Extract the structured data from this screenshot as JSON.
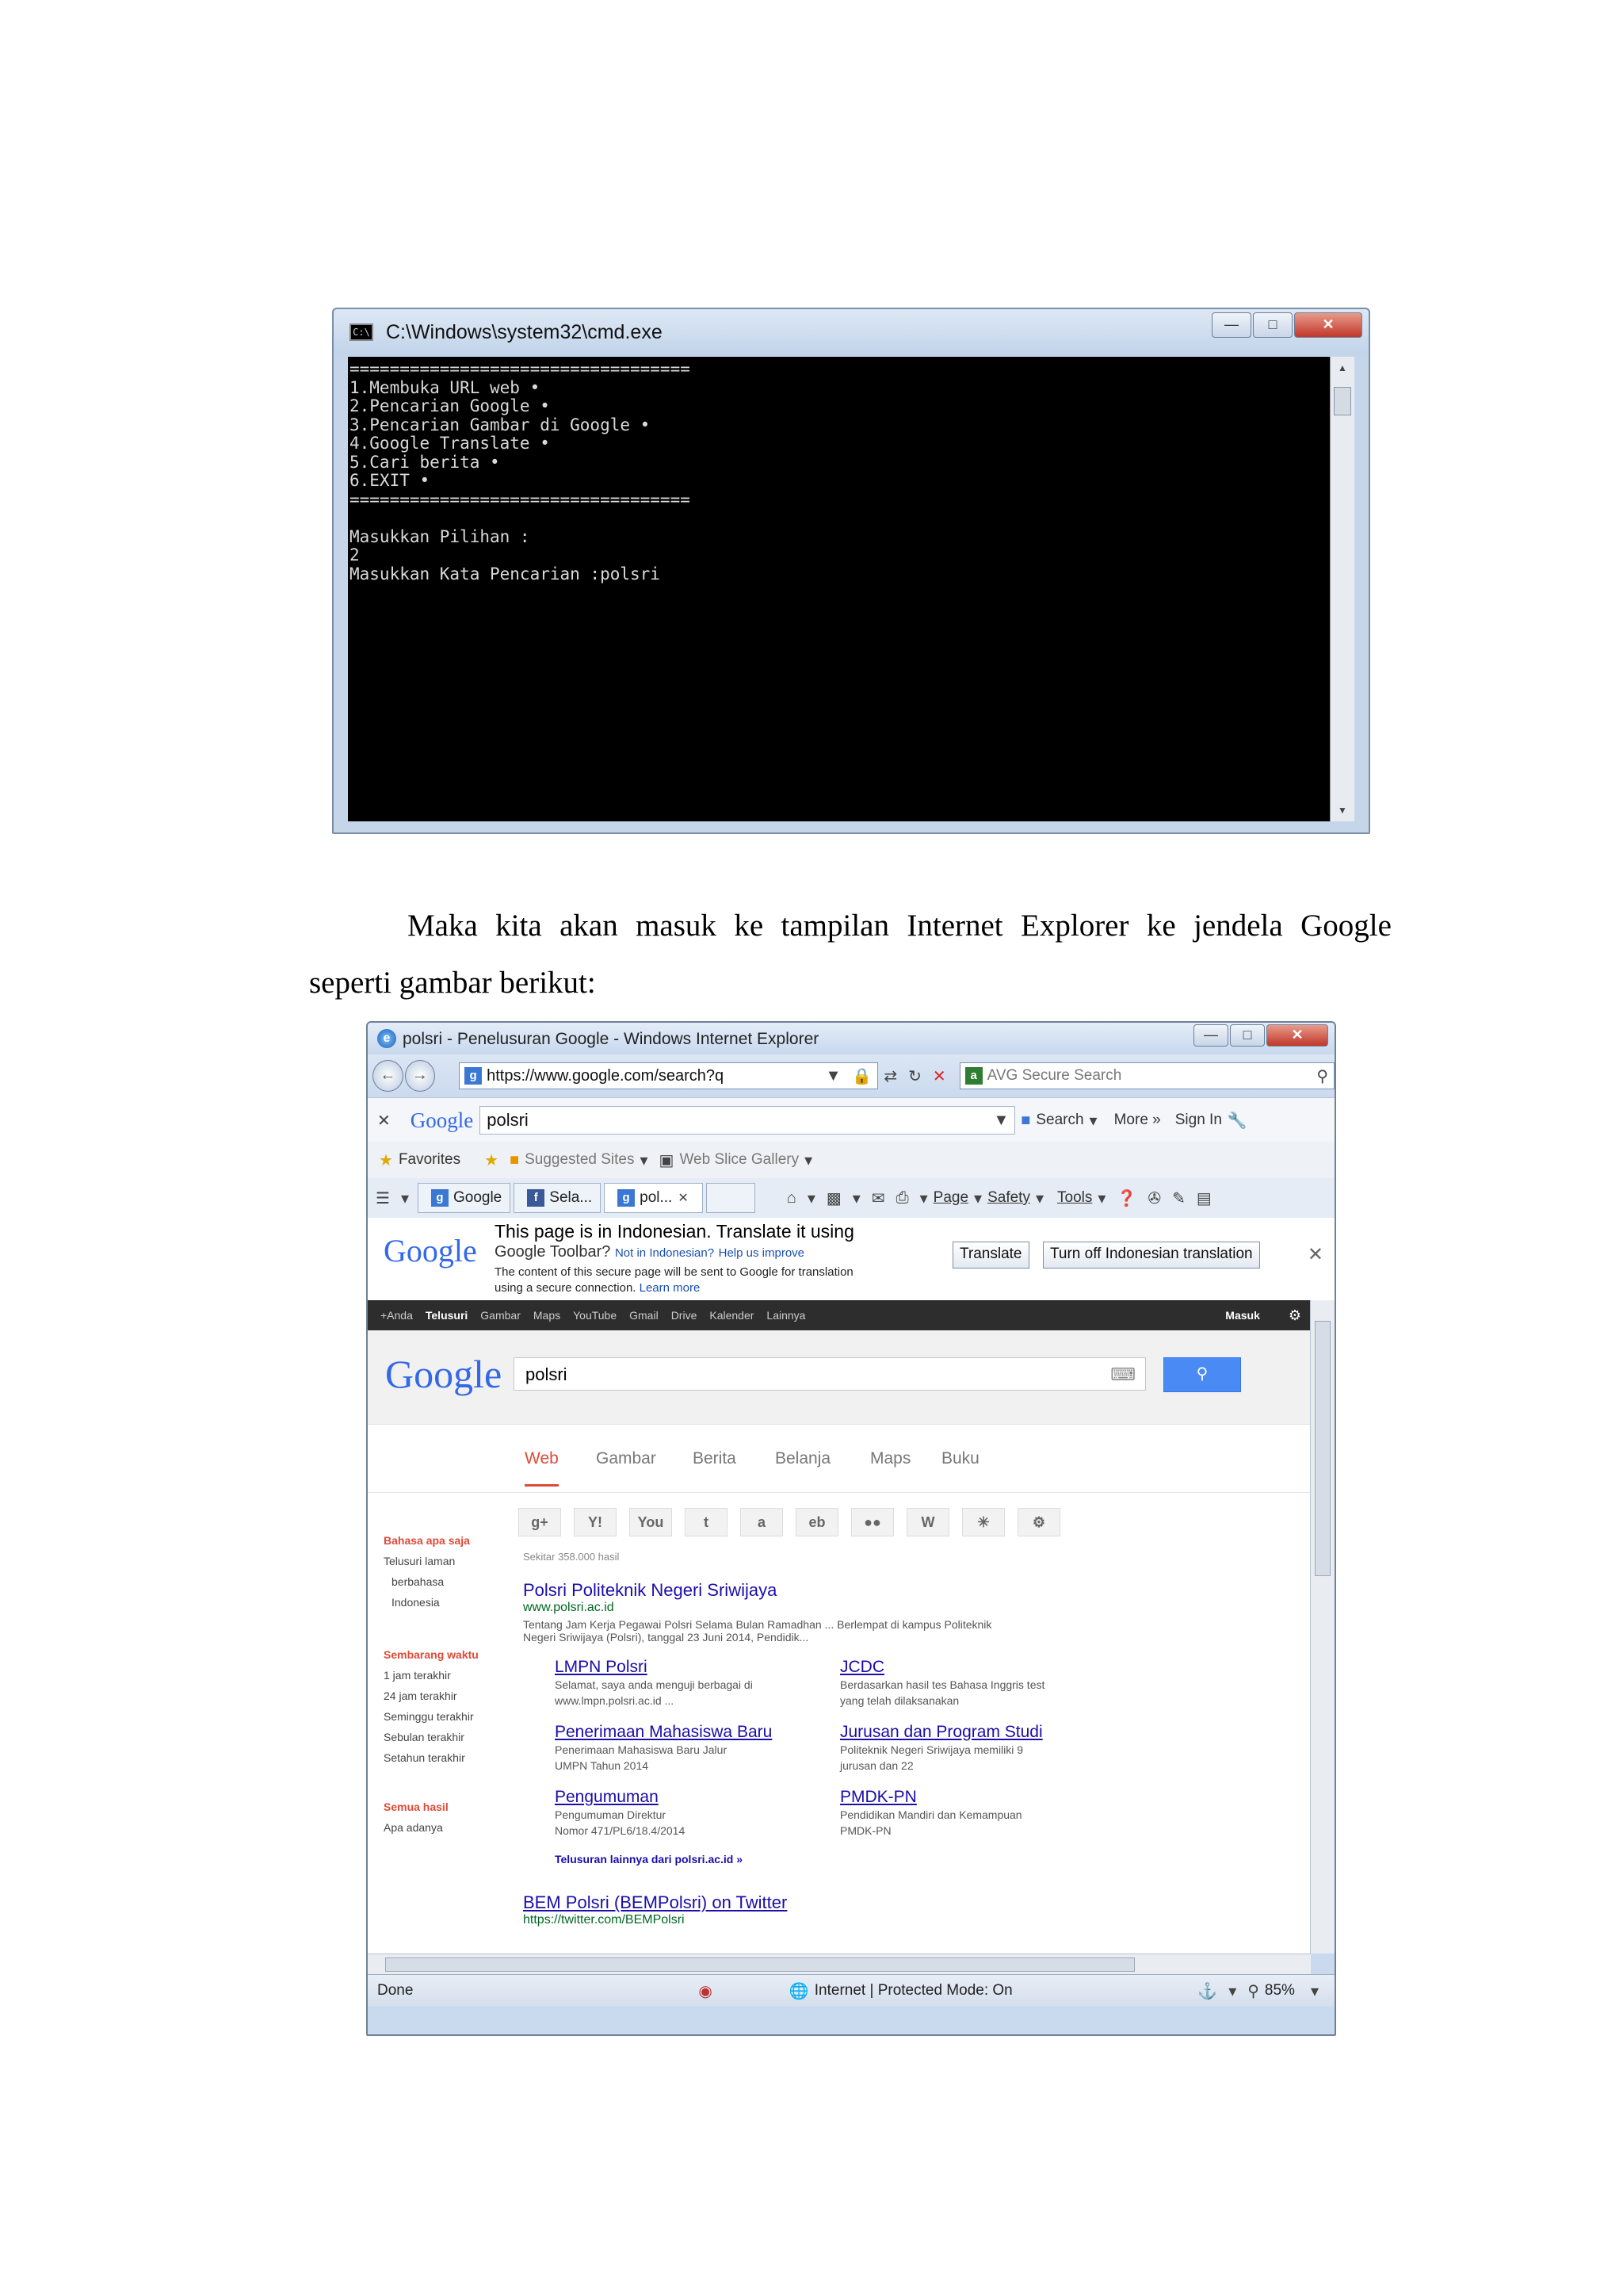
{
  "cmd_window": {
    "title": "C:\\Windows\\system32\\cmd.exe",
    "lines": [
      "==================================",
      "1.Membuka URL web •",
      "2.Pencarian Google •",
      "3.Pencarian Gambar di Google •",
      "4.Google Translate •",
      "5.Cari berita •",
      "6.EXIT •",
      "==================================",
      "",
      "Masukkan Pilihan :",
      "2",
      "Masukkan Kata Pencarian :polsri"
    ]
  },
  "paragraph": {
    "line1_words": [
      "Maka",
      "kita",
      "akan",
      "masuk",
      "ke",
      "tampilan",
      "Internet",
      "Explorer",
      "ke",
      "jendela",
      "Google"
    ],
    "line2": "seperti gambar berikut:"
  },
  "ie_window": {
    "title": "polsri - Penelusuran Google - Windows Internet Explorer",
    "address": "https://www.google.com/search?q",
    "search_placeholder": "AVG Secure Search",
    "google_toolbar": {
      "logo": "Google",
      "query": "polsri",
      "search_label": "Search",
      "more_label": "More »",
      "signin_label": "Sign In"
    },
    "favorites": {
      "favorites_label": "Favorites",
      "suggested_label": "Suggested Sites",
      "webslice_label": "Web Slice Gallery"
    },
    "tabs": [
      {
        "label": "Google"
      },
      {
        "label": "Sela..."
      },
      {
        "label": "pol..."
      }
    ],
    "command_bar": {
      "page": "Page",
      "safety": "Safety",
      "tools": "Tools"
    },
    "translate_bar": {
      "logo": "Google",
      "line1": "This page is in Indonesian.  Translate it using",
      "line2a": "Google Toolbar?",
      "line2b": "Not in Indonesian?",
      "line2c": "Help us improve",
      "line3": "The content of this secure page will be sent to Google for translation",
      "line4a": "using a secure connection.",
      "line4b": "Learn more",
      "translate_btn": "Translate",
      "turnoff_btn": "Turn off Indonesian translation"
    },
    "google_bar": {
      "items": [
        "+Anda",
        "Telusuri",
        "Gambar",
        "Maps",
        "YouTube",
        "Gmail",
        "Drive",
        "Kalender",
        "Lainnya"
      ],
      "masuk": "Masuk"
    },
    "google_search": {
      "logo": "Google",
      "query": "polsri"
    },
    "google_tabs": [
      "Web",
      "Gambar",
      "Berita",
      "Belanja",
      "Maps",
      "Buku"
    ],
    "left_col": {
      "lang_header": "Bahasa apa saja",
      "lang_items": [
        "Telusuri laman",
        "berbahasa",
        "Indonesia"
      ],
      "time_header": "Sembarang waktu",
      "time_items": [
        "1 jam terakhir",
        "24 jam terakhir",
        "Seminggu terakhir",
        "Sebulan terakhir",
        "Setahun terakhir"
      ],
      "all_header": "Semua hasil",
      "all_items": [
        "Apa adanya"
      ]
    },
    "result_stats": "Sekitar 358.000 hasil",
    "results": [
      {
        "title": "Polsri Politeknik Negeri Sriwijaya",
        "url": "www.polsri.ac.id",
        "snippet1": "Tentang Jam Kerja Pegawai Polsri Selama Bulan Ramadhan ... Berlempat di kampus Politeknik",
        "snippet2": "Negeri Sriwijaya (Polsri), tanggal 23 Juni 2014, Pendidik..."
      }
    ],
    "sitelinks": [
      {
        "title": "LMPN Polsri",
        "desc1": "Selamat, saya anda menguji berbagai di",
        "desc2": "www.lmpn.polsri.ac.id ..."
      },
      {
        "title": "JCDC",
        "desc1": "Berdasarkan hasil tes Bahasa Inggris test",
        "desc2": "yang telah dilaksanakan"
      },
      {
        "title": "Penerimaan Mahasiswa Baru",
        "desc1": "Penerimaan Mahasiswa Baru Jalur",
        "desc2": "UMPN Tahun 2014"
      },
      {
        "title": "Jurusan dan Program Studi",
        "desc1": "Politeknik Negeri Sriwijaya memiliki 9",
        "desc2": "jurusan dan 22"
      },
      {
        "title": "Pengumuman",
        "desc1": "Pengumuman Direktur",
        "desc2": "Nomor 471/PL6/18.4/2014"
      },
      {
        "title": "PMDK-PN",
        "desc1": "Pendidikan Mandiri dan Kemampuan",
        "desc2": "PMDK-PN"
      }
    ],
    "more_results": "Telusuran lainnya dari polsri.ac.id »",
    "result2": {
      "title": "BEM Polsri (BEMPolsri) on Twitter",
      "url": "https://twitter.com/BEMPolsri"
    },
    "status": {
      "left": "Done",
      "zone": "Internet | Protected Mode: On",
      "zoom": "85%"
    }
  }
}
